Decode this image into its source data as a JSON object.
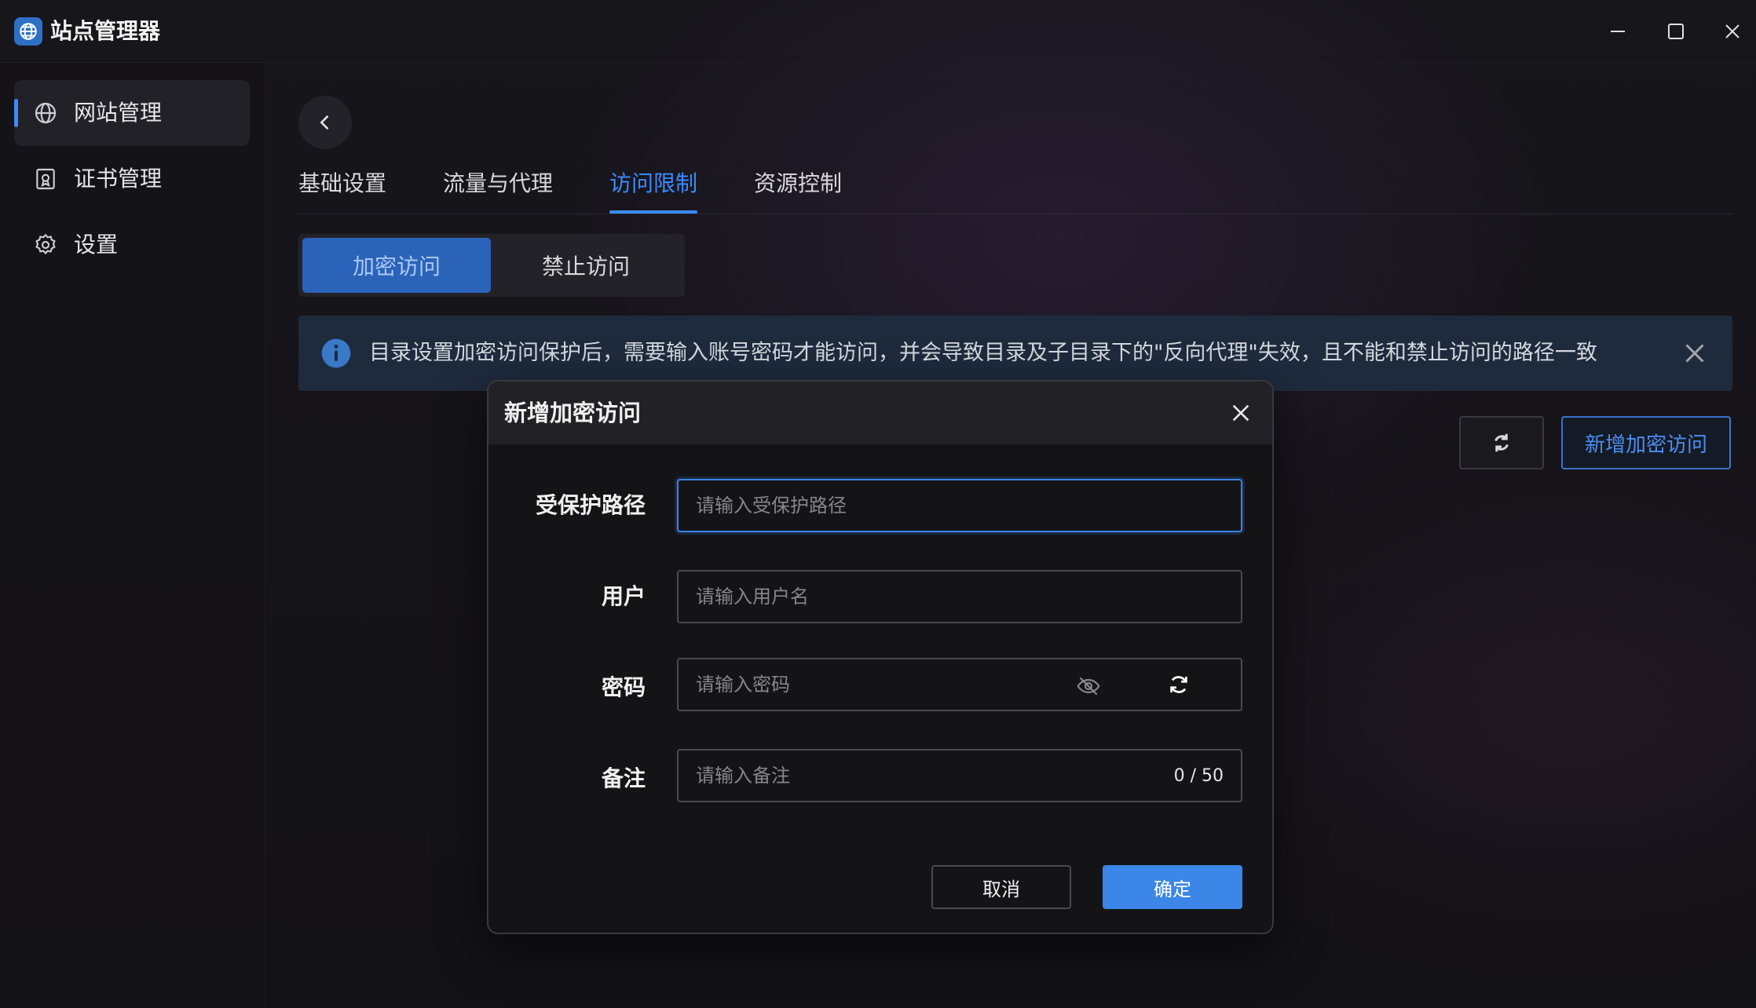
{
  "window": {
    "title": "站点管理器",
    "app_icon": "globe-icon",
    "controls": [
      "minimize-icon",
      "maximize-icon",
      "close-icon"
    ]
  },
  "sidebar": {
    "items": [
      {
        "label": "网站管理",
        "icon": "globe-icon",
        "active": true
      },
      {
        "label": "证书管理",
        "icon": "certificate-icon",
        "active": false
      },
      {
        "label": "设置",
        "icon": "gear-icon",
        "active": false
      }
    ]
  },
  "tabs": [
    {
      "label": "基础设置",
      "active": false
    },
    {
      "label": "流量与代理",
      "active": false
    },
    {
      "label": "访问限制",
      "active": true
    },
    {
      "label": "资源控制",
      "active": false
    }
  ],
  "segment": {
    "items": [
      {
        "label": "加密访问",
        "active": true
      },
      {
        "label": "禁止访问",
        "active": false
      }
    ]
  },
  "alert": {
    "text": "目录设置加密访问保护后，需要输入账号密码才能访问，并会导致目录及子目录下的\"反向代理\"失效，且不能和禁止访问的路径一致"
  },
  "toolbar": {
    "add_label": "新增加密访问"
  },
  "dialog": {
    "title": "新增加密访问",
    "fields": {
      "path": {
        "label": "受保护路径",
        "placeholder": "请输入受保护路径",
        "value": ""
      },
      "user": {
        "label": "用户",
        "placeholder": "请输入用户名",
        "value": ""
      },
      "password": {
        "label": "密码",
        "placeholder": "请输入密码",
        "value": ""
      },
      "note": {
        "label": "备注",
        "placeholder": "请输入备注",
        "value": "",
        "counter": "0 / 50"
      }
    },
    "cancel_label": "取消",
    "ok_label": "确定"
  },
  "colors": {
    "accent": "#3b86e6",
    "background": "#121214",
    "alert_bg": "#1e2b3d"
  }
}
